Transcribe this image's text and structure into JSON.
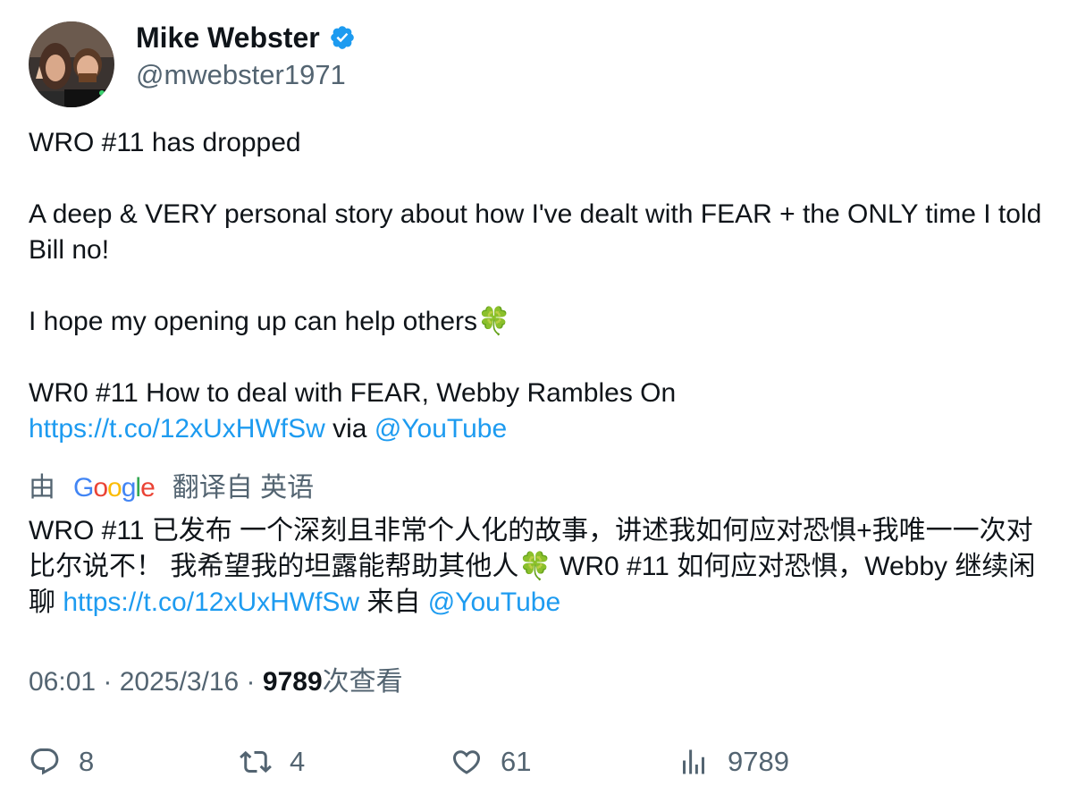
{
  "author": {
    "display_name": "Mike Webster",
    "handle": "@mwebster1971",
    "verified_color": "#1d9bf0",
    "avatar_icon": "avatar-photo"
  },
  "tweet": {
    "line1": "WRO #11 has dropped",
    "line2": "A deep & VERY personal story about how I've dealt with FEAR + the ONLY time I told Bill no!",
    "line3": "I hope my opening up can help others",
    "clover": "🍀",
    "line4": "WR0 #11 How to deal with FEAR, Webby Rambles On",
    "link": "https://t.co/12xUxHWfSw",
    "via": "via",
    "mention": "@YouTube"
  },
  "translation": {
    "prefix": "由",
    "provider": "Google",
    "suffix": "翻译自 英语",
    "text_a": "WRO #11 已发布 一个深刻且非常个人化的故事，讲述我如何应对恐惧+我唯一一次对比尔说不！ 我希望我的坦露能帮助其他人",
    "clover": "🍀",
    "text_b": " WR0 #11 如何应对恐惧，Webby 继续闲聊 ",
    "link": "https://t.co/12xUxHWfSw",
    "from": " 来自 ",
    "mention": "@YouTube"
  },
  "meta": {
    "time": "06:01",
    "sep1": " · ",
    "date": "2025/3/16",
    "sep2": " · ",
    "views_count": "9789",
    "views_label": "次查看"
  },
  "actions": {
    "replies": "8",
    "retweets": "4",
    "likes": "61",
    "views": "9789"
  },
  "colors": {
    "link": "#1d9bf0",
    "muted": "#536471",
    "text": "#0f1419"
  }
}
